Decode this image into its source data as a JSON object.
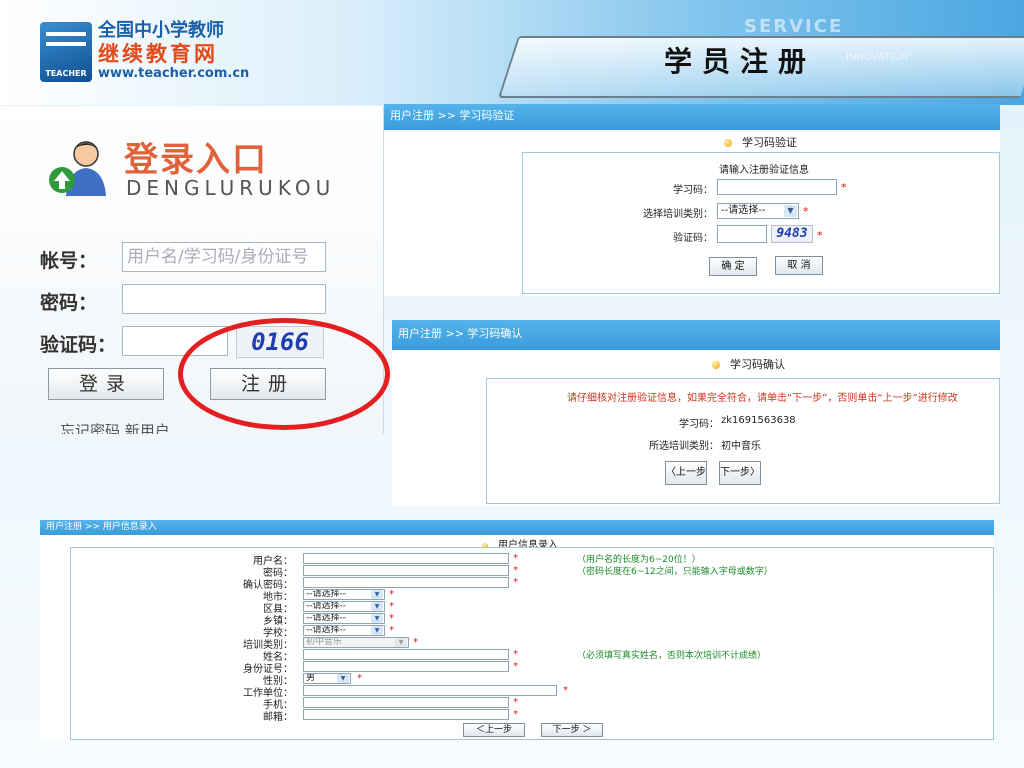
{
  "slide": {
    "title": "学员注册"
  },
  "logo": {
    "line1": "全国中小学教师",
    "line2": "继续教育网",
    "url": "www.teacher.com.cn",
    "mark_text": "TEACHER"
  },
  "decor": {
    "service": "SERVICE",
    "innovation": "INNOVATION"
  },
  "login": {
    "title": "登录入口",
    "pinyin": "DENGLURUKOU",
    "account_label": "帐号：",
    "account_placeholder": "用户名/学习码/身份证号",
    "password_label": "密码：",
    "captcha_label": "验证码：",
    "captcha_value": "0166",
    "login_button": "登录",
    "register_button": "注册",
    "bottom_links": "忘记密码        新用户"
  },
  "verify_panel": {
    "breadcrumb": "用户注册 >> 学习码验证",
    "section_title": "学习码验证",
    "prompt": "请输入注册验证信息",
    "code_label": "学习码：",
    "category_label": "选择培训类别：",
    "category_value": "--请选择--",
    "captcha_label": "验证码：",
    "captcha_value": "9483",
    "confirm_button": "确 定",
    "cancel_button": "取 消"
  },
  "confirm_panel": {
    "breadcrumb": "用户注册 >> 学习码确认",
    "section_title": "学习码确认",
    "notice": "请仔细核对注册验证信息，如果完全符合，请单击“下一步”，否则单击“上一步”进行修改",
    "code_label": "学习码：",
    "code_value": "zk1691563638",
    "category_label": "所选培训类别：",
    "category_value": "初中音乐",
    "prev_button": "〈上一步",
    "next_button": "下一步〉"
  },
  "info_panel": {
    "breadcrumb": "用户注册 >> 用户信息录入",
    "section_title": "用户信息录入",
    "fields": {
      "username": "用户名：",
      "password": "密码：",
      "confirm_password": "确认密码：",
      "city": "地市：",
      "district": "区县：",
      "town": "乡镇：",
      "school": "学校：",
      "category": "培训类别：",
      "name": "姓名：",
      "id_number": "身份证号：",
      "gender": "性别：",
      "workplace": "工作单位：",
      "phone": "手机：",
      "email": "邮箱："
    },
    "select_placeholder": "--请选择--",
    "category_value": "初中音乐",
    "gender_value": "男",
    "hints": {
      "username": "（用户名的长度为6~20位！）",
      "password": "（密码长度在6~12之间，只能输入字母或数字）",
      "name": "（必须填写真实姓名，否则本次培训不计成绩）"
    },
    "prev_button": "＜上一步",
    "next_button": "下一步 ＞"
  },
  "required_mark": "*",
  "colors": {
    "accent_blue": "#3a9cdb",
    "highlight_red": "#e41f1f",
    "hint_green": "#1c8a2a"
  }
}
